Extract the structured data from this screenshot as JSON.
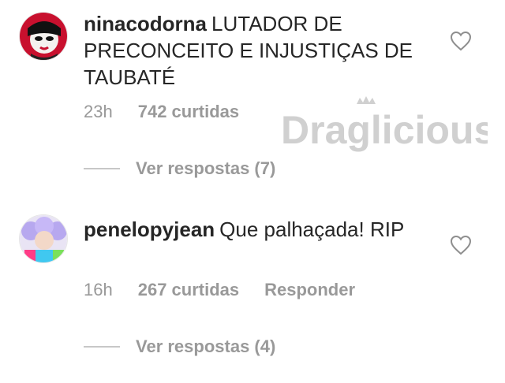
{
  "comments": [
    {
      "username": "ninacodorna",
      "text": "LUTADOR DE PRECONCEITO E INJUSTIÇAS DE TAUBATÉ",
      "time": "23h",
      "likes": "742 curtidas",
      "reply_label": "",
      "view_replies": "Ver respostas (7)",
      "icon": "heart-outline-icon"
    },
    {
      "username": "penelopyjean",
      "text": "Que palhaçada! RIP",
      "time": "16h",
      "likes": "267 curtidas",
      "reply_label": "Responder",
      "view_replies": "Ver respostas (4)",
      "icon": "heart-outline-icon"
    }
  ],
  "watermark": {
    "text": "Draglicious"
  },
  "colors": {
    "text": "#262626",
    "muted": "#999999",
    "watermark": "#d0d0d0"
  }
}
